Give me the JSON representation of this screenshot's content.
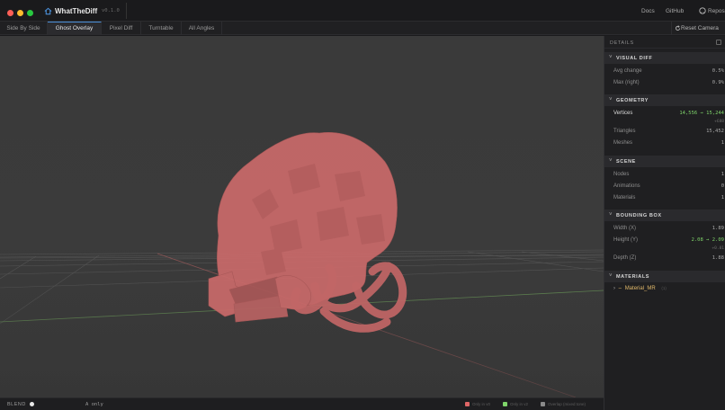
{
  "app": {
    "title": "WhatTheDiff",
    "version": "v0.1.0"
  },
  "toplinks": {
    "docs": "Docs",
    "github": "GitHub",
    "repos": "Repos"
  },
  "tabs": [
    "Side By Side",
    "Ghost Overlay",
    "Pixel Diff",
    "Turntable",
    "All Angles"
  ],
  "active_tab": "Ghost Overlay",
  "reset_camera": "Reset Camera",
  "panel": {
    "title": "DETAILS",
    "visual_diff": {
      "title": "VISUAL DIFF",
      "rows": [
        {
          "label": "Avg change",
          "value": "0.5%"
        },
        {
          "label": "Max (right)",
          "value": "0.9%"
        }
      ]
    },
    "geometry": {
      "title": "GEOMETRY",
      "vertices_label": "Vertices",
      "vertices_value": "14,556 → 15,244",
      "vertices_delta": "+688",
      "rows": [
        {
          "label": "Triangles",
          "value": "15,452"
        },
        {
          "label": "Meshes",
          "value": "1"
        }
      ]
    },
    "scene": {
      "title": "SCENE",
      "rows": [
        {
          "label": "Nodes",
          "value": "1"
        },
        {
          "label": "Animations",
          "value": "0"
        },
        {
          "label": "Materials",
          "value": "1"
        }
      ]
    },
    "bounding_box": {
      "title": "BOUNDING BOX",
      "width_label": "Width (X)",
      "width_value": "1.89",
      "height_label": "Height (Y)",
      "height_value": "2.08 → 2.09",
      "height_delta": "+0.01",
      "depth_label": "Depth (Z)",
      "depth_value": "1.88"
    },
    "materials": {
      "title": "MATERIALS",
      "item": "Material_MR",
      "item_count": "(1)"
    }
  },
  "bottom": {
    "blend_label": "BLEND",
    "blend_value": "A only",
    "legend": [
      {
        "label": "Only in v0",
        "color": "#e06666"
      },
      {
        "label": "Only in v2",
        "color": "#7fd46a"
      },
      {
        "label": "Overlap (mixed tone)",
        "color": "#8a8a8a"
      }
    ]
  },
  "colors": {
    "accent": "#4a8fd8",
    "model": "#c96a6a",
    "positive": "#7fd46a",
    "material": "#e0b86a"
  }
}
